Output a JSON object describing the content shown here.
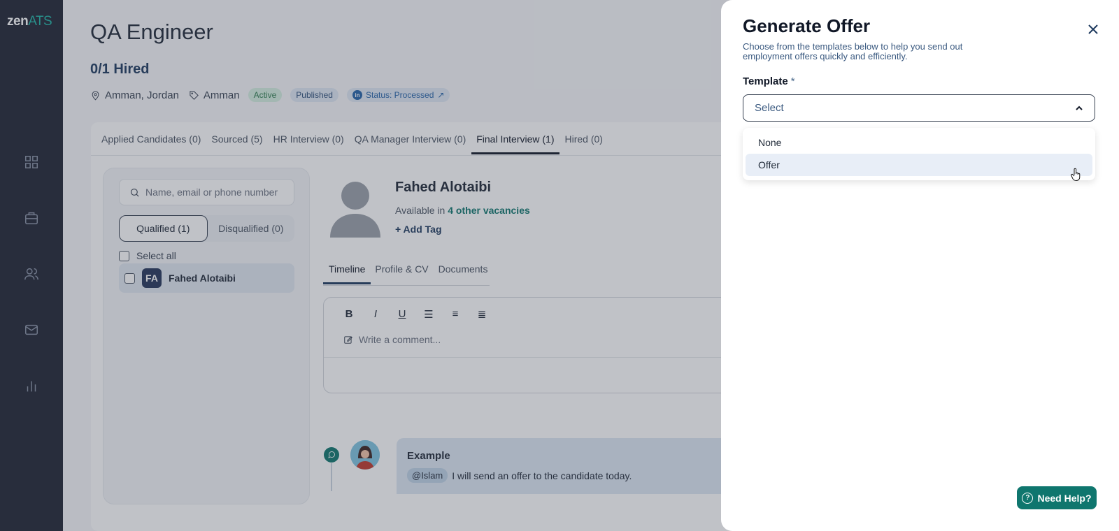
{
  "app": {
    "logo_main": "zen",
    "logo_accent": "ATS"
  },
  "sidebar": {
    "items": [
      "dashboard-icon",
      "briefcase-icon",
      "users-icon",
      "mail-icon",
      "chart-icon"
    ]
  },
  "job": {
    "title": "QA Engineer",
    "hired": "0/1 Hired",
    "location": "Amman, Jordan",
    "tag": "Amman",
    "badges": {
      "active": "Active",
      "published": "Published",
      "status": "Status: Processed"
    }
  },
  "stage_tabs": [
    "Applied Candidates (0)",
    "Sourced (5)",
    "HR Interview (0)",
    "QA Manager Interview (0)",
    "Final Interview (1)",
    "Hired (0)"
  ],
  "candidates": {
    "search_placeholder": "Name, email or phone number",
    "qualified": "Qualified (1)",
    "disqualified": "Disqualified (0)",
    "select_all": "Select all",
    "list": [
      {
        "initials": "FA",
        "name": "Fahed Alotaibi"
      }
    ]
  },
  "profile": {
    "name": "Fahed Alotaibi",
    "available_prefix": "Available in",
    "available_link": "4 other vacancies",
    "add_tag": "+ Add Tag",
    "tabs": [
      "Timeline",
      "Profile & CV",
      "Documents"
    ],
    "editor": {
      "toolbar": [
        "B",
        "I",
        "U"
      ],
      "comment_placeholder": "Write a comment..."
    },
    "timeline": {
      "title": "Example",
      "mention": "@Islam",
      "text": "I will send an offer to the candidate today."
    }
  },
  "drawer": {
    "title": "Generate Offer",
    "subtitle": "Choose from the templates below to help you send out employment offers quickly and efficiently.",
    "template_label": "Template",
    "required_mark": "*",
    "select_value": "Select",
    "options": [
      "None",
      "Offer"
    ],
    "hovered_option": "Offer"
  },
  "help_button": "Need Help?",
  "colors": {
    "sidebar": "#1f2433",
    "accent": "#0f766e",
    "navy": "#1e3a5f"
  }
}
